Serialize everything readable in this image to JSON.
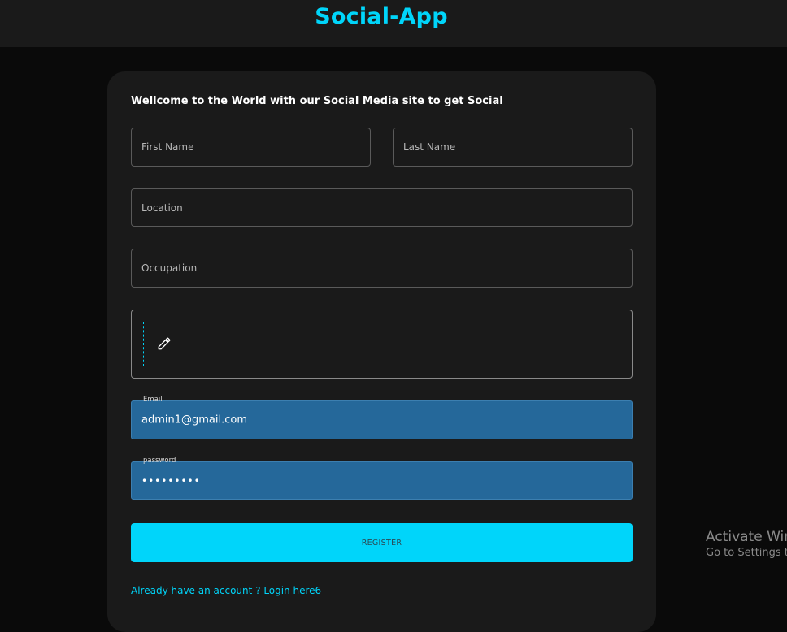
{
  "header": {
    "brand": "Social-App"
  },
  "form": {
    "welcome": "Wellcome to the World with our Social Media site to get Social",
    "first_name": {
      "placeholder": "First Name",
      "value": ""
    },
    "last_name": {
      "placeholder": "Last Name",
      "value": ""
    },
    "location": {
      "placeholder": "Location",
      "value": ""
    },
    "occupation": {
      "placeholder": "Occupation",
      "value": ""
    },
    "picture": {
      "icon": "pencil-icon"
    },
    "email": {
      "label": "Email",
      "value": "admin1@gmail.com"
    },
    "password": {
      "label": "password",
      "value": "•••••••••"
    },
    "register_label": "REGISTER",
    "login_link": "Already have an account ? Login here6"
  },
  "watermark": {
    "line1": "Activate Windows",
    "line2": "Go to Settings to activate Windows."
  },
  "colors": {
    "accent": "#00d5fa",
    "background": "#0a0a0a",
    "card": "#1a1a1a",
    "filled_input": "#25689a"
  }
}
